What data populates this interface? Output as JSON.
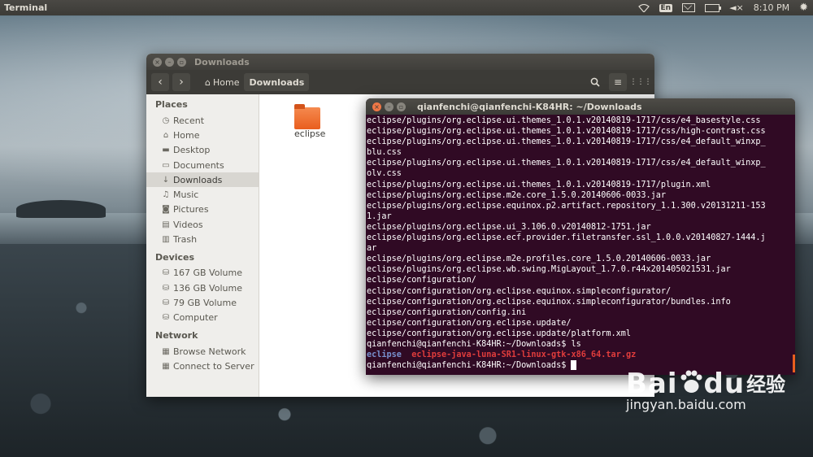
{
  "top_panel": {
    "title": "Terminal",
    "keyboard_layout": "En",
    "clock": "8:10 PM"
  },
  "files_window": {
    "title": "Downloads",
    "breadcrumbs": [
      "Home",
      "Downloads"
    ],
    "sidebar": {
      "places_heading": "Places",
      "places": [
        {
          "label": "Recent",
          "icon": "clock-icon"
        },
        {
          "label": "Home",
          "icon": "home-icon"
        },
        {
          "label": "Desktop",
          "icon": "desktop-icon"
        },
        {
          "label": "Documents",
          "icon": "document-icon"
        },
        {
          "label": "Downloads",
          "icon": "download-icon",
          "selected": true
        },
        {
          "label": "Music",
          "icon": "music-icon"
        },
        {
          "label": "Pictures",
          "icon": "camera-icon"
        },
        {
          "label": "Videos",
          "icon": "film-icon"
        },
        {
          "label": "Trash",
          "icon": "trash-icon"
        }
      ],
      "devices_heading": "Devices",
      "devices": [
        {
          "label": "167 GB Volume",
          "icon": "drive-icon"
        },
        {
          "label": "136 GB Volume",
          "icon": "drive-icon"
        },
        {
          "label": "79 GB Volume",
          "icon": "drive-icon"
        },
        {
          "label": "Computer",
          "icon": "drive-icon"
        }
      ],
      "network_heading": "Network",
      "network": [
        {
          "label": "Browse Network",
          "icon": "network-icon"
        },
        {
          "label": "Connect to Server",
          "icon": "server-icon"
        }
      ]
    },
    "items": [
      {
        "label": "eclipse",
        "icon": "folder-icon"
      }
    ]
  },
  "terminal": {
    "title": "qianfenchi@qianfenchi-K84HR: ~/Downloads",
    "lines": [
      "eclipse/plugins/org.eclipse.ui.themes_1.0.1.v20140819-1717/css/e4_basestyle.css",
      "eclipse/plugins/org.eclipse.ui.themes_1.0.1.v20140819-1717/css/high-contrast.css",
      "eclipse/plugins/org.eclipse.ui.themes_1.0.1.v20140819-1717/css/e4_default_winxp_",
      "blu.css",
      "eclipse/plugins/org.eclipse.ui.themes_1.0.1.v20140819-1717/css/e4_default_winxp_",
      "olv.css",
      "eclipse/plugins/org.eclipse.ui.themes_1.0.1.v20140819-1717/plugin.xml",
      "eclipse/plugins/org.eclipse.m2e.core_1.5.0.20140606-0033.jar",
      "eclipse/plugins/org.eclipse.equinox.p2.artifact.repository_1.1.300.v20131211-153",
      "1.jar",
      "eclipse/plugins/org.eclipse.ui_3.106.0.v20140812-1751.jar",
      "eclipse/plugins/org.eclipse.ecf.provider.filetransfer.ssl_1.0.0.v20140827-1444.j",
      "ar",
      "eclipse/plugins/org.eclipse.m2e.profiles.core_1.5.0.20140606-0033.jar",
      "eclipse/plugins/org.eclipse.wb.swing.MigLayout_1.7.0.r44x201405021531.jar",
      "eclipse/configuration/",
      "eclipse/configuration/org.eclipse.equinox.simpleconfigurator/",
      "eclipse/configuration/org.eclipse.equinox.simpleconfigurator/bundles.info",
      "eclipse/configuration/config.ini",
      "eclipse/configuration/org.eclipse.update/",
      "eclipse/configuration/org.eclipse.update/platform.xml",
      "qianfenchi@qianfenchi-K84HR:~/Downloads$ ls"
    ],
    "ls_output": {
      "dir": "eclipse",
      "archive": "eclipse-java-luna-SR1-linux-gtk-x86_64.tar.gz"
    },
    "prompt": "qianfenchi@qianfenchi-K84HR:~/Downloads$ "
  },
  "watermark": {
    "brand": "Bai",
    "brand_suffix": "du",
    "chinese": "经验",
    "url": "jingyan.baidu.com"
  },
  "colors": {
    "terminal_bg": "#300a24",
    "accent_orange": "#e95e1e",
    "ls_dir": "#7891cf",
    "ls_archive": "#e03c3c"
  }
}
